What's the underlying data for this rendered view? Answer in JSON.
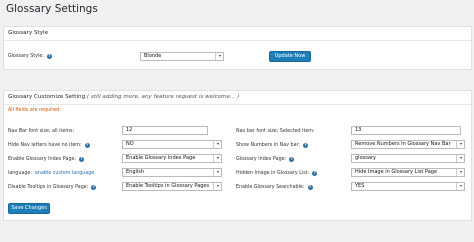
{
  "page": {
    "title": "Glossary Settings"
  },
  "style_box": {
    "title": "Glossary Style",
    "style_label": "Glossary Style:",
    "style_value": "Blonde",
    "update_button": "Update Now"
  },
  "custom_box": {
    "title": "Glossary Customize Setting",
    "hint": "( still adding more, any feature request is welcome... )",
    "required": "All fields are required:",
    "rows": [
      {
        "left_label": "Nav Bar font size, all items:",
        "left_value": "12",
        "right_label": "Nav bar font size, Selected item:",
        "right_value": "13"
      },
      {
        "left_label": "Hide Nav letters have no item:",
        "left_value": "NO",
        "right_label": "Show Numbers in Nav bar:",
        "right_value": "Remove Numbers In Glossary Nav Bar"
      },
      {
        "left_label": "Enable Glossary Index Page:",
        "left_value": "Enable Glossary Index Page",
        "right_label": "Glossary Index Page:",
        "right_value": "glossary"
      },
      {
        "left_label": "language:",
        "left_link": "enable custom language",
        "left_value": "English",
        "right_label": "Hidden Image in Glossary List:",
        "right_value": "Hide Image in Glossary List Page"
      },
      {
        "left_label": "Disable Tooltips in Glossary Page:",
        "left_value": "Enable Tooltips in Glossary Pages",
        "right_label": "Enable Glossary Searchable:",
        "right_value": "YES"
      }
    ],
    "save_button": "Save Changes"
  },
  "icons": {
    "help": "help-circle-icon",
    "dropdown": "chevron-down-icon"
  },
  "colors": {
    "accent": "#1e7fb8",
    "required": "#d35400",
    "help": "#2e6c9e"
  }
}
